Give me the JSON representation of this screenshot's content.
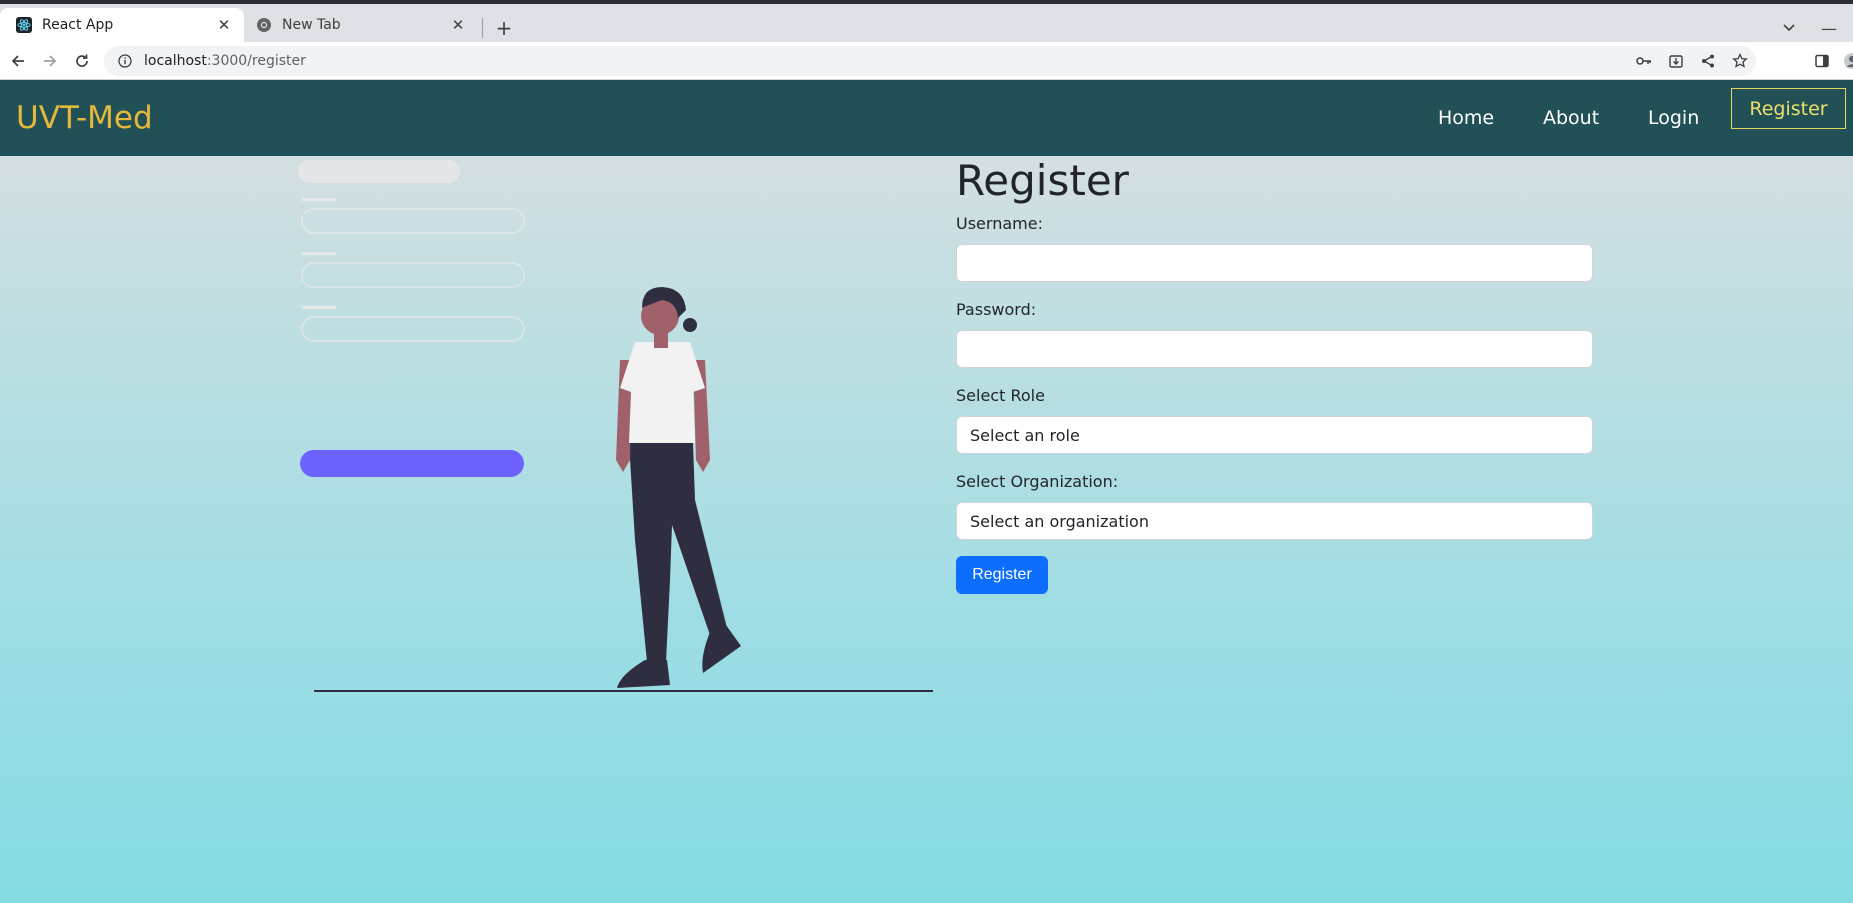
{
  "browser": {
    "tabs": [
      {
        "title": "React App",
        "active": true,
        "icon": "react-icon"
      },
      {
        "title": "New Tab",
        "active": false,
        "icon": "chrome-icon"
      }
    ],
    "url_host": "localhost",
    "url_path": ":3000/register"
  },
  "navbar": {
    "brand": "UVT-Med",
    "links": [
      {
        "label": "Home"
      },
      {
        "label": "About"
      },
      {
        "label": "Login"
      }
    ],
    "register": "Register",
    "colors": {
      "background": "#215157",
      "brand": "#e4b83a",
      "register_border": "#e4d65a"
    }
  },
  "form": {
    "title": "Register",
    "username_label": "Username:",
    "username_value": "",
    "password_label": "Password:",
    "password_value": "",
    "role_label": "Select Role",
    "role_value": "Select an role",
    "org_label": "Select Organization:",
    "org_value": "Select an organization",
    "submit_label": "Register",
    "colors": {
      "submit": "#0d6efd"
    }
  },
  "illustration": {
    "icon": "person-walking-illustration",
    "accent": "#6c63ff"
  }
}
